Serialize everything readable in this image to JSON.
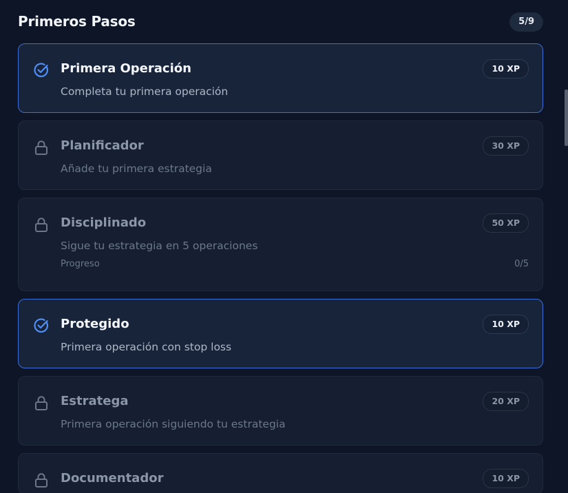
{
  "header": {
    "title": "Primeros Pasos",
    "count": "5/9"
  },
  "colors": {
    "background": "#0d1526",
    "card": "#151f31",
    "card_completed": "#18243a",
    "accent": "#3d6fd6",
    "check": "#4f8ff7"
  },
  "achievements": [
    {
      "title": "Primera Operación",
      "description": "Completa tu primera operación",
      "xp": "10 XP",
      "status": "completed",
      "icon": "check-circle-icon"
    },
    {
      "title": "Planificador",
      "description": "Añade tu primera estrategia",
      "xp": "30 XP",
      "status": "locked",
      "icon": "lock-icon"
    },
    {
      "title": "Disciplinado",
      "description": "Sigue tu estrategia en 5 operaciones",
      "xp": "50 XP",
      "status": "locked",
      "icon": "lock-icon",
      "progress_label": "Progreso",
      "progress_value": "0/5"
    },
    {
      "title": "Protegido",
      "description": "Primera operación con stop loss",
      "xp": "10 XP",
      "status": "completed",
      "icon": "check-circle-icon"
    },
    {
      "title": "Estratega",
      "description": "Primera operación siguiendo tu estrategia",
      "xp": "20 XP",
      "status": "locked",
      "icon": "lock-icon"
    },
    {
      "title": "Documentador",
      "xp": "10 XP",
      "status": "locked",
      "icon": "lock-icon"
    }
  ]
}
